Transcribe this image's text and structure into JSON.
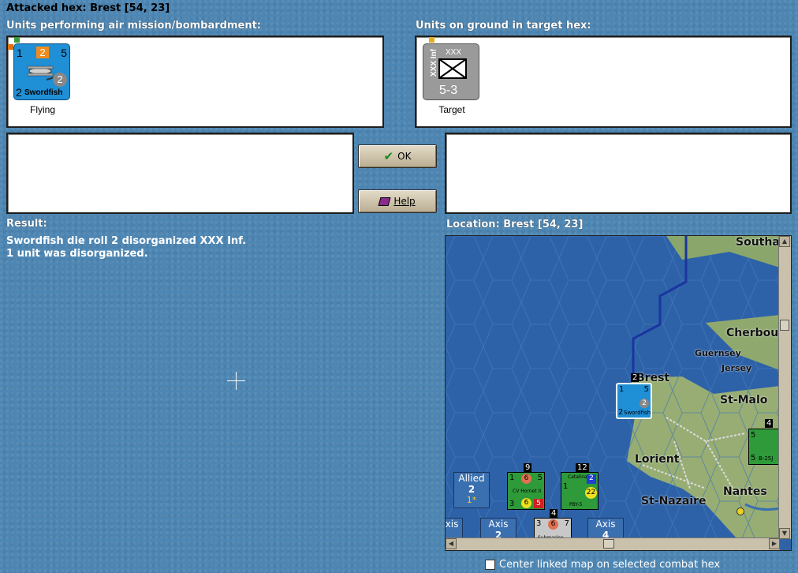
{
  "header": {
    "attacked_hex": "Attacked hex: Brest  [54, 23]"
  },
  "air_panel": {
    "title": "Units performing air mission/bombardment:",
    "unit": {
      "name": "Swordfish",
      "top_left": "1",
      "top_mid": "2",
      "top_right": "5",
      "mid": "2",
      "bottom_left": "2",
      "status": "Flying"
    }
  },
  "ground_panel": {
    "title": "Units on ground in target hex:",
    "unit": {
      "side_label": "XXX Inf",
      "size": "XXX",
      "strength": "5-3",
      "status": "Target"
    }
  },
  "buttons": {
    "ok_label": "OK",
    "help_label": "Help"
  },
  "result": {
    "title": "Result:",
    "line1": "Swordfish die roll 2 disorganized XXX Inf.",
    "line2": "1 unit was disorganized."
  },
  "location": {
    "title": "Location:  Brest  [54, 23]"
  },
  "map": {
    "places": {
      "brest": "Brest",
      "cherbourg": "Cherbou",
      "guernsey": "Guernsey",
      "jersey": "Jersey",
      "st_malo": "St-Malo",
      "lorient": "Lorient",
      "st_nazaire": "St-Nazaire",
      "nantes": "Nantes",
      "southampton": "Southa"
    },
    "stacks": {
      "allied": {
        "title": "Allied",
        "count": "2",
        "sub": "1*"
      },
      "axis_left": {
        "title": "xis",
        "count": ""
      },
      "axis_mid": {
        "title": "Axis",
        "count": "2"
      },
      "axis_right": {
        "title": "Axis",
        "count": "4"
      }
    },
    "units": {
      "brest_swordfish": {
        "top_count": "2",
        "name": "Swordfish",
        "left": "2",
        "right": "2",
        "tl": "1",
        "tr": "5"
      },
      "cv_hornet": {
        "top_count": "9",
        "name": "CV Hornet II",
        "tl": "1",
        "tm": "6",
        "tr": "5",
        "bl": "3",
        "bm": "6",
        "br": "5"
      },
      "pby": {
        "top_count": "12",
        "name": "PBY-5",
        "title": "Catalina",
        "a": "1",
        "b": "2",
        "c": "22"
      },
      "submarine": {
        "top_count": "4",
        "name": "Submarine",
        "a": "3",
        "b": "6",
        "c": "7"
      },
      "b25": {
        "top_count": "4",
        "name": "B-25J",
        "a": "5",
        "b": "5"
      }
    }
  },
  "footer": {
    "center_label": "Center linked map on selected combat hex"
  }
}
